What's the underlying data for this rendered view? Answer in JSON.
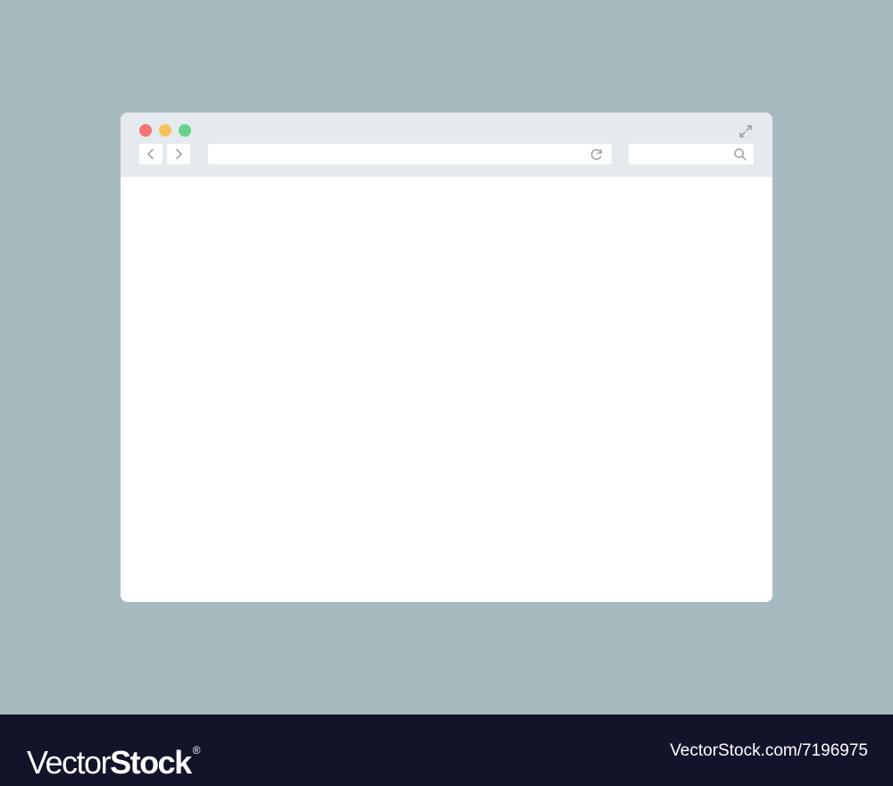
{
  "colors": {
    "background": "#a7babf",
    "chrome": "#e5eaee",
    "window": "#ffffff",
    "close": "#f27474",
    "minimize": "#f7c25c",
    "zoom": "#65d38b",
    "icon": "#9aa4aa",
    "footer": "#12142a",
    "footer_text": "#ffffff"
  },
  "browser": {
    "traffic_lights": [
      "close",
      "minimize",
      "zoom"
    ],
    "icons": {
      "expand": "expand-arrows-icon",
      "back": "chevron-left-icon",
      "forward": "chevron-right-icon",
      "reload": "reload-icon",
      "search": "magnifier-icon"
    },
    "address_bar": {
      "value": "",
      "placeholder": ""
    },
    "search_box": {
      "value": "",
      "placeholder": ""
    }
  },
  "watermark": {
    "brand_light": "Vector",
    "brand_bold": "Stock",
    "brand_reg": "®",
    "credit": "VectorStock.com/7196975"
  }
}
